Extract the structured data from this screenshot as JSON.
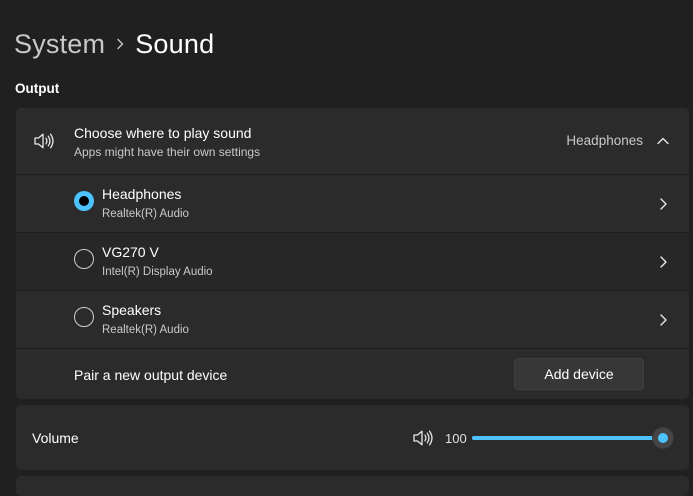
{
  "breadcrumb": {
    "parent": "System",
    "current": "Sound"
  },
  "output": {
    "section_label": "Output",
    "header": {
      "title": "Choose where to play sound",
      "subtitle": "Apps might have their own settings",
      "current_value": "Headphones",
      "icon": "speaker-icon"
    },
    "devices": [
      {
        "name": "Headphones",
        "subtitle": "Realtek(R) Audio",
        "selected": true
      },
      {
        "name": "VG270 V",
        "subtitle": "Intel(R) Display Audio",
        "selected": false
      },
      {
        "name": "Speakers",
        "subtitle": "Realtek(R) Audio",
        "selected": false
      }
    ],
    "pair": {
      "label": "Pair a new output device",
      "button_label": "Add device"
    }
  },
  "volume": {
    "label": "Volume",
    "value": "100",
    "level": 100,
    "icon": "speaker-icon"
  },
  "colors": {
    "accent": "#4cc2ff",
    "background": "#202020",
    "card": "#2b2b2b"
  }
}
